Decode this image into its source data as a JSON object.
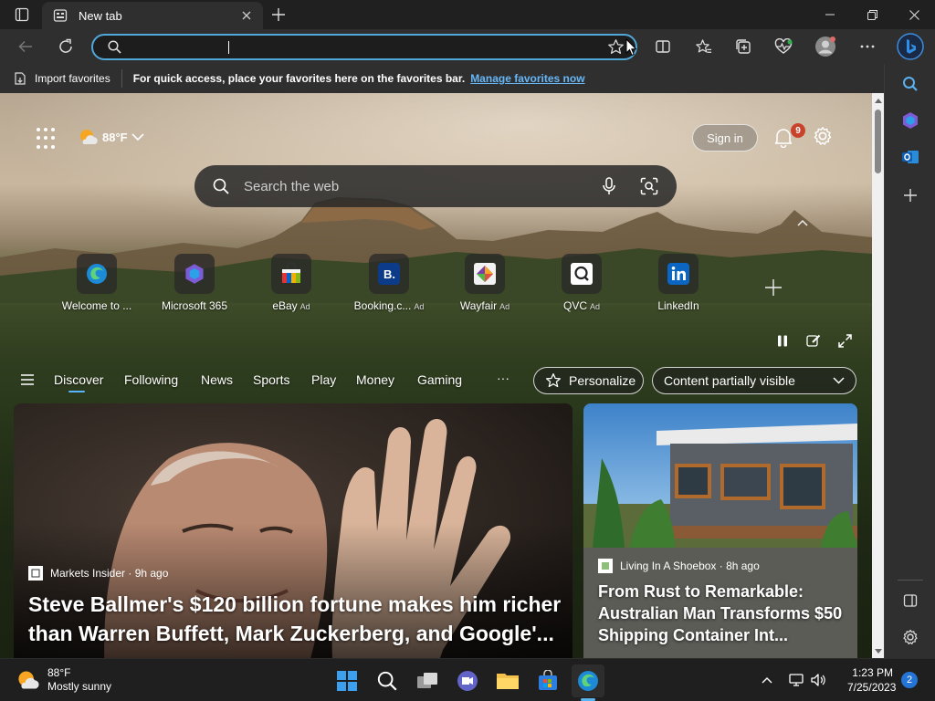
{
  "browser": {
    "tab_title": "New tab",
    "address_placeholder": "",
    "favorites_bar": {
      "import_label": "Import favorites",
      "message": "For quick access, place your favorites here on the favorites bar.",
      "manage_link": "Manage favorites now"
    }
  },
  "newtab": {
    "weather": {
      "temp": "88°F"
    },
    "sign_in": "Sign in",
    "notification_count": "9",
    "search_placeholder": "Search the web",
    "quick_links": [
      {
        "label": "Welcome to ...",
        "ad": "",
        "icon": "edge-icon"
      },
      {
        "label": "Microsoft 365",
        "ad": "",
        "icon": "m365-icon"
      },
      {
        "label": "eBay",
        "ad": "Ad",
        "icon": "ebay-icon"
      },
      {
        "label": "Booking.c...",
        "ad": "Ad",
        "icon": "booking-icon"
      },
      {
        "label": "Wayfair",
        "ad": "Ad",
        "icon": "wayfair-icon"
      },
      {
        "label": "QVC",
        "ad": "Ad",
        "icon": "qvc-icon"
      },
      {
        "label": "LinkedIn",
        "ad": "",
        "icon": "linkedin-icon"
      }
    ],
    "feed_tabs": [
      "Discover",
      "Following",
      "News",
      "Sports",
      "Play",
      "Money",
      "Gaming"
    ],
    "more": "···",
    "personalize": "Personalize",
    "content_visibility": "Content partially visible",
    "cards": {
      "main": {
        "source": "Markets Insider · 9h ago",
        "headline": "Steve Ballmer's $120 billion fortune makes him richer than Warren Buffett, Mark Zuckerberg, and Google'..."
      },
      "side": {
        "source": "Living In A Shoebox · 8h ago",
        "headline": "From Rust to Remarkable: Australian Man Transforms $50 Shipping Container Int..."
      }
    }
  },
  "taskbar": {
    "weather_temp": "88°F",
    "weather_desc": "Mostly sunny",
    "time": "1:23 PM",
    "date": "7/25/2023",
    "notifications": "2"
  },
  "colors": {
    "accent": "#4fa8d8",
    "link": "#67b7f7",
    "badge": "#c8432c"
  }
}
